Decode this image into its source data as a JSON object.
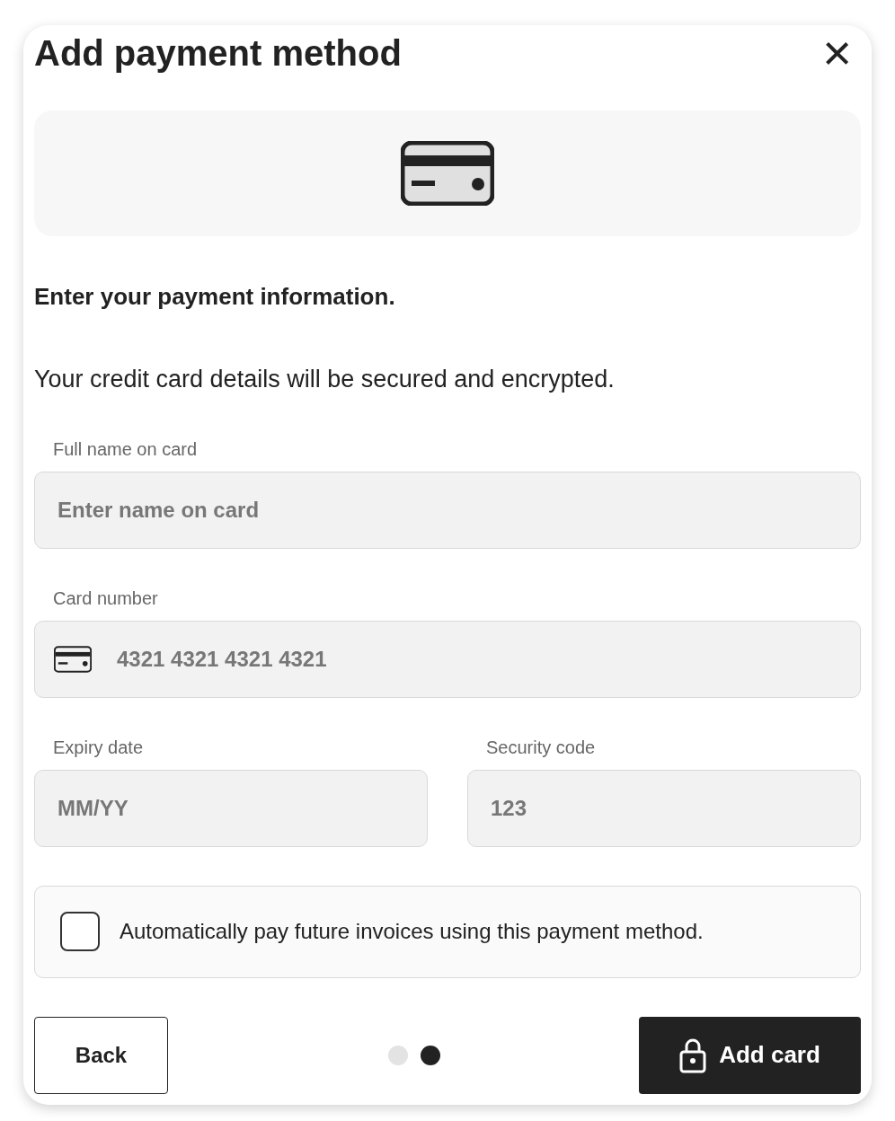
{
  "dialog": {
    "title": "Add payment method",
    "close": "×"
  },
  "heading": "Enter your payment information.",
  "description": "Your credit card details will be secured and encrypted.",
  "fields": [
    {
      "label": "Full name on card",
      "placeholder": "Enter name on card",
      "kind": "text"
    },
    {
      "label": "Card number",
      "placeholder": "4321 4321 4321 4321",
      "kind": "card"
    }
  ],
  "row_fields": [
    {
      "label": "Expiry date",
      "placeholder": "MM/YY"
    },
    {
      "label": "Security code",
      "placeholder": "123"
    }
  ],
  "autopay": {
    "label": "Automatically pay future invoices using this payment method.",
    "checked": false
  },
  "footer": {
    "back": "Back",
    "submit": "Add card",
    "steps": [
      {
        "selected": false
      },
      {
        "selected": true
      }
    ]
  }
}
